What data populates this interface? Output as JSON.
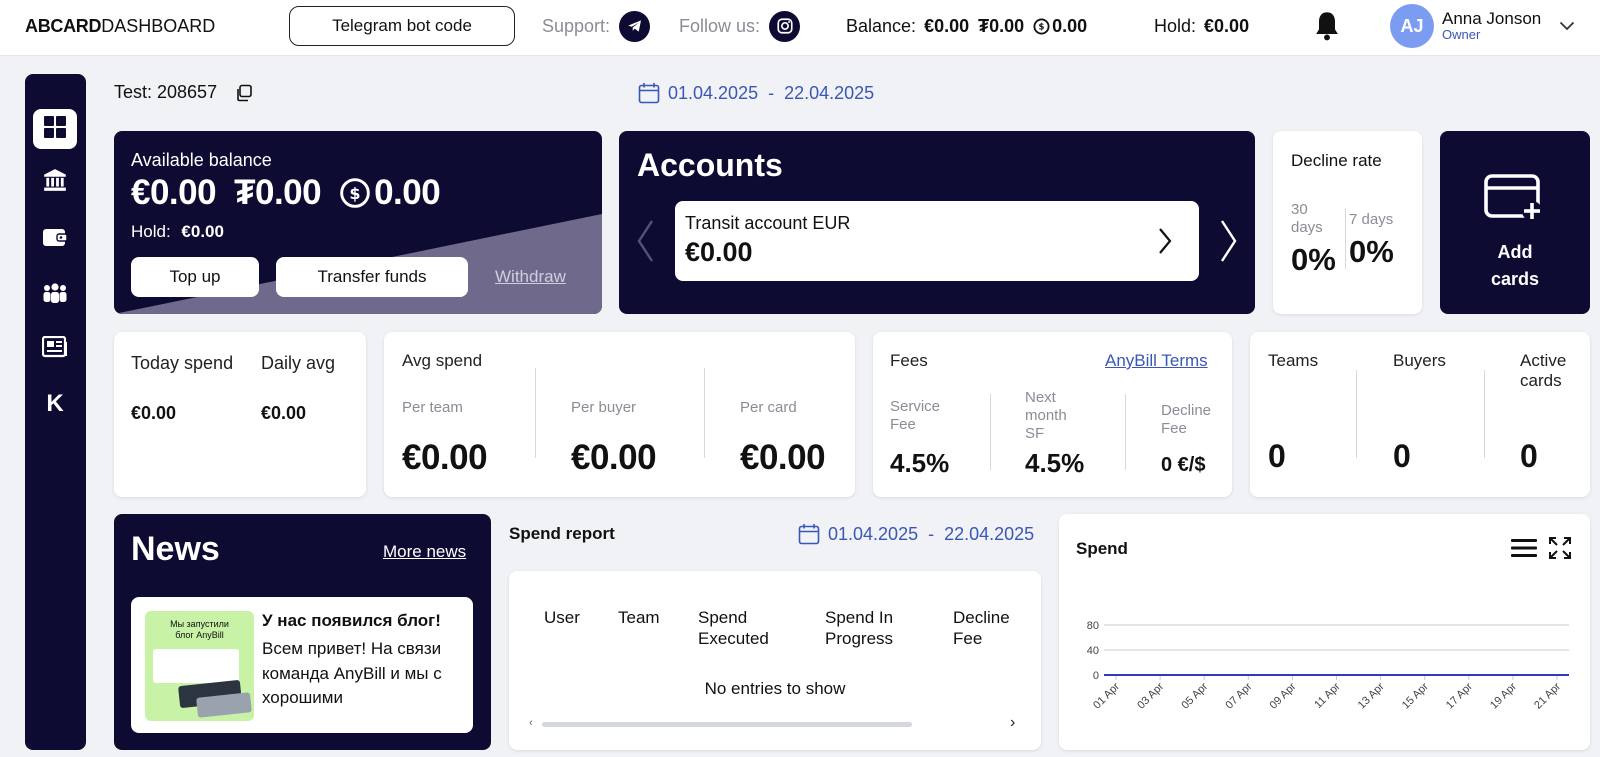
{
  "header": {
    "logo_bold": "ABCARD",
    "logo_light": "DASHBOARD",
    "telegram_button": "Telegram bot code",
    "support_label": "Support:",
    "follow_label": "Follow us:",
    "balance_label": "Balance:",
    "balance_eur": "€0.00",
    "balance_uah": "₮0.00",
    "balance_usdc": "0.00",
    "hold_label": "Hold:",
    "hold_value": "€0.00",
    "user_initials": "AJ",
    "user_name": "Anna Jonson",
    "user_role": "Owner"
  },
  "sidebar": {
    "items": [
      "dashboard",
      "bank",
      "wallet",
      "teams",
      "news",
      "K"
    ]
  },
  "test_id": "Test: 208657",
  "date_range": {
    "from": "01.04.2025",
    "sep": "-",
    "to": "22.04.2025"
  },
  "available_balance": {
    "title": "Available balance",
    "eur": "€0.00",
    "uah": "₮0.00",
    "usdc": "0.00",
    "hold_label": "Hold:",
    "hold_value": "€0.00",
    "top_up": "Top up",
    "transfer": "Transfer funds",
    "withdraw": "Withdraw"
  },
  "accounts": {
    "title": "Accounts",
    "item_name": "Transit account EUR",
    "item_value": "€0.00"
  },
  "decline_rate": {
    "title": "Decline rate",
    "p30_label_a": "30",
    "p30_label_b": "days",
    "p30_value": "0%",
    "p7_label": "7 days",
    "p7_value": "0%"
  },
  "add_cards": {
    "line1": "Add",
    "line2": "cards"
  },
  "today_spend": {
    "today_label": "Today spend",
    "today_value": "€0.00",
    "avg_label": "Daily avg",
    "avg_value": "€0.00"
  },
  "avg_spend": {
    "title": "Avg spend",
    "per_team_label": "Per team",
    "per_team": "€0.00",
    "per_buyer_label": "Per buyer",
    "per_buyer": "€0.00",
    "per_card_label": "Per card",
    "per_card": "€0.00"
  },
  "fees": {
    "title": "Fees",
    "terms_link": "AnyBill Terms",
    "service_label_1": "Service",
    "service_label_2": "Fee",
    "service_value": "4.5%",
    "next_label_1": "Next",
    "next_label_2": "month",
    "next_label_3": "SF",
    "next_value": "4.5%",
    "decline_label_1": "Decline",
    "decline_label_2": "Fee",
    "decline_value": "0 €/$"
  },
  "counts": {
    "teams_label": "Teams",
    "teams": "0",
    "buyers_label": "Buyers",
    "buyers": "0",
    "active_label_1": "Active",
    "active_label_2": "cards",
    "active": "0"
  },
  "news": {
    "title": "News",
    "more": "More news",
    "thumb_line1": "Мы запустили",
    "thumb_line2": "блог AnyBill",
    "post_title": "У нас появился блог!",
    "post_line1": "Всем привет! На связи",
    "post_line2": "команда AnyBill и мы с",
    "post_line3": "хорошими"
  },
  "spend_report": {
    "title": "Spend report",
    "columns": [
      "User",
      "Team",
      "Spend\nExecuted",
      "Spend In\nProgress",
      "Decline\nFee"
    ],
    "col_a": [
      "User",
      "Team",
      "Spend",
      "Spend In",
      "Decline"
    ],
    "col_b": [
      "",
      "",
      "Executed",
      "Progress",
      "Fee"
    ],
    "empty": "No entries to show"
  },
  "chart_data": {
    "type": "line",
    "title": "Spend",
    "x": [
      "01 Apr",
      "03 Apr",
      "05 Apr",
      "07 Apr",
      "09 Apr",
      "11 Apr",
      "13 Apr",
      "15 Apr",
      "17 Apr",
      "19 Apr",
      "21 Apr"
    ],
    "series": [
      {
        "values": [
          0,
          0,
          0,
          0,
          0,
          0,
          0,
          0,
          0,
          0,
          0
        ]
      }
    ],
    "ylim": [
      0,
      80
    ],
    "yticks": [
      0,
      40,
      80
    ],
    "grid": true,
    "line_color": "#2f3bb8"
  },
  "colors": {
    "navy": "#0e0b33",
    "accent": "#3b57b5",
    "avatar": "#7b9cf0"
  }
}
